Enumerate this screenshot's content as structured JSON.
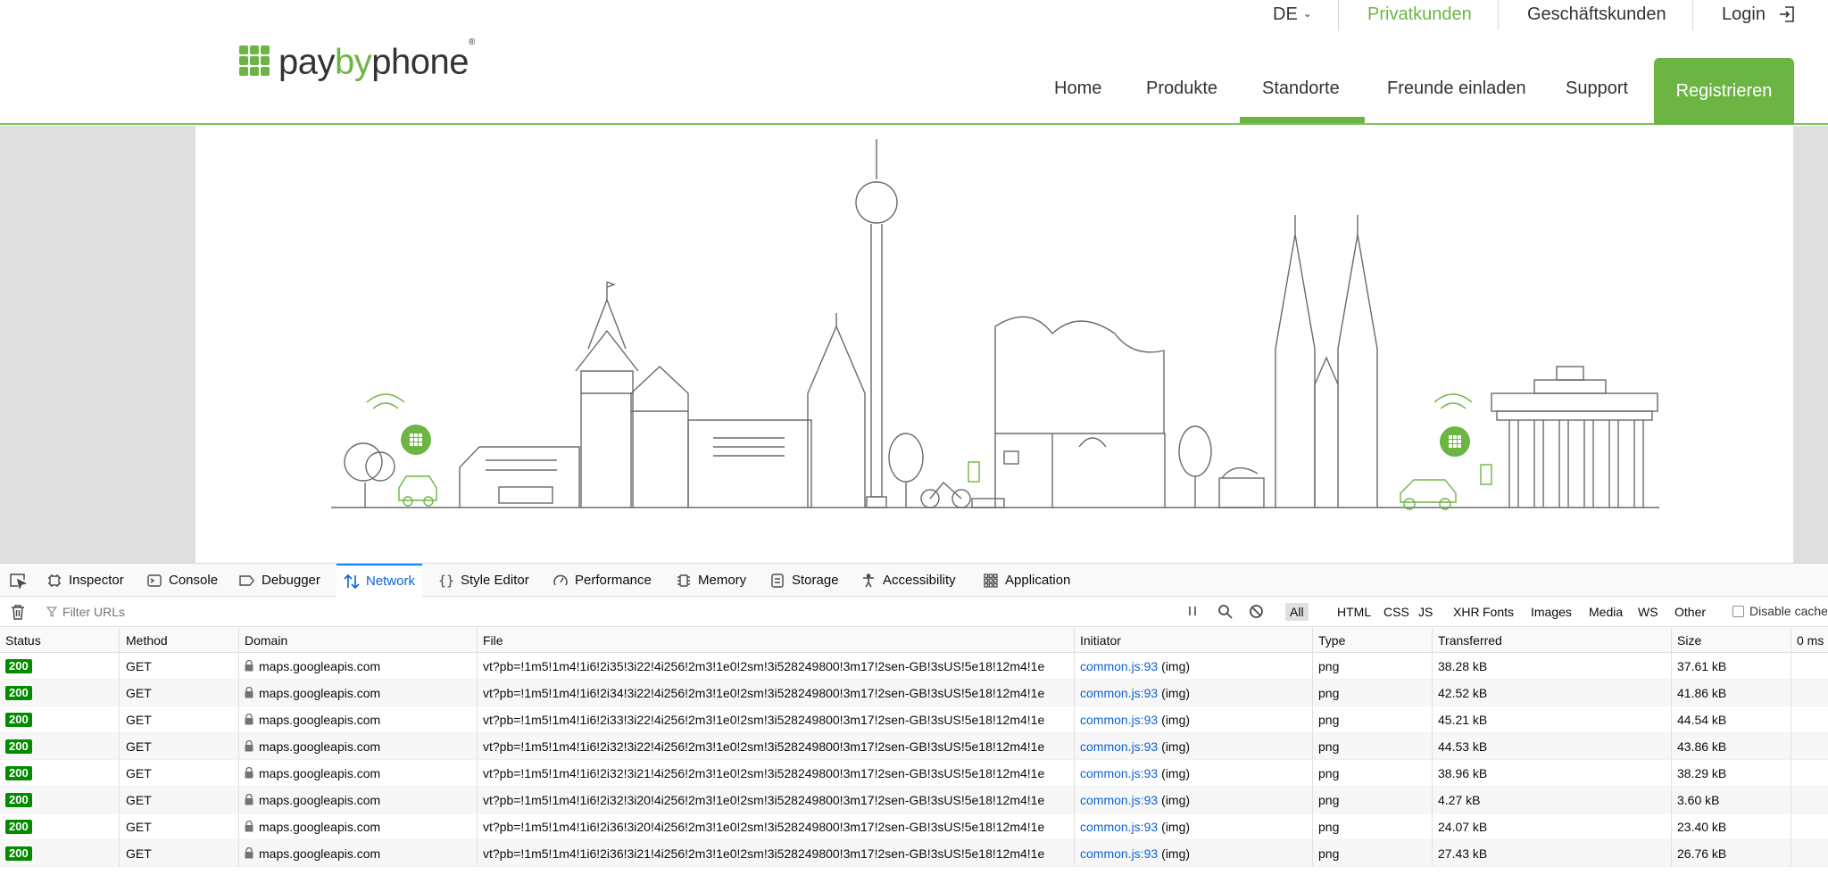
{
  "site": {
    "util": {
      "lang": "DE",
      "privat": "Privatkunden",
      "geschaeft": "Geschäftskunden",
      "login": "Login"
    },
    "logo": {
      "prefix": "pay",
      "mid": "by",
      "suffix": "phone"
    },
    "nav": {
      "home": "Home",
      "produkte": "Produkte",
      "standorte": "Standorte",
      "freunde": "Freunde einladen",
      "support": "Support",
      "register": "Registrieren"
    },
    "accent": "#6cb544"
  },
  "devtools": {
    "tabs": {
      "inspector": "Inspector",
      "console": "Console",
      "debugger": "Debugger",
      "network": "Network",
      "style_editor": "Style Editor",
      "performance": "Performance",
      "memory": "Memory",
      "storage": "Storage",
      "accessibility": "Accessibility",
      "application": "Application"
    },
    "filter_placeholder": "Filter URLs",
    "filters": {
      "all": "All",
      "html": "HTML",
      "css": "CSS",
      "js": "JS",
      "xhr": "XHR",
      "fonts": "Fonts",
      "images": "Images",
      "media": "Media",
      "ws": "WS",
      "other": "Other"
    },
    "disable_cache": "Disable cache",
    "columns": {
      "status": "Status",
      "method": "Method",
      "domain": "Domain",
      "file": "File",
      "initiator": "Initiator",
      "type": "Type",
      "transferred": "Transferred",
      "size": "Size",
      "waterfall": "0 ms"
    },
    "rows": [
      {
        "status": "200",
        "method": "GET",
        "domain": "maps.googleapis.com",
        "file": "vt?pb=!1m5!1m4!1i6!2i35!3i22!4i256!2m3!1e0!2sm!3i528249800!3m17!2sen-GB!3sUS!5e18!12m4!1e",
        "initiator": "common.js:93",
        "initiator_type": "(img)",
        "type": "png",
        "transferred": "38.28 kB",
        "size": "37.61 kB"
      },
      {
        "status": "200",
        "method": "GET",
        "domain": "maps.googleapis.com",
        "file": "vt?pb=!1m5!1m4!1i6!2i34!3i22!4i256!2m3!1e0!2sm!3i528249800!3m17!2sen-GB!3sUS!5e18!12m4!1e",
        "initiator": "common.js:93",
        "initiator_type": "(img)",
        "type": "png",
        "transferred": "42.52 kB",
        "size": "41.86 kB"
      },
      {
        "status": "200",
        "method": "GET",
        "domain": "maps.googleapis.com",
        "file": "vt?pb=!1m5!1m4!1i6!2i33!3i22!4i256!2m3!1e0!2sm!3i528249800!3m17!2sen-GB!3sUS!5e18!12m4!1e",
        "initiator": "common.js:93",
        "initiator_type": "(img)",
        "type": "png",
        "transferred": "45.21 kB",
        "size": "44.54 kB"
      },
      {
        "status": "200",
        "method": "GET",
        "domain": "maps.googleapis.com",
        "file": "vt?pb=!1m5!1m4!1i6!2i32!3i22!4i256!2m3!1e0!2sm!3i528249800!3m17!2sen-GB!3sUS!5e18!12m4!1e",
        "initiator": "common.js:93",
        "initiator_type": "(img)",
        "type": "png",
        "transferred": "44.53 kB",
        "size": "43.86 kB"
      },
      {
        "status": "200",
        "method": "GET",
        "domain": "maps.googleapis.com",
        "file": "vt?pb=!1m5!1m4!1i6!2i32!3i21!4i256!2m3!1e0!2sm!3i528249800!3m17!2sen-GB!3sUS!5e18!12m4!1e",
        "initiator": "common.js:93",
        "initiator_type": "(img)",
        "type": "png",
        "transferred": "38.96 kB",
        "size": "38.29 kB"
      },
      {
        "status": "200",
        "method": "GET",
        "domain": "maps.googleapis.com",
        "file": "vt?pb=!1m5!1m4!1i6!2i32!3i20!4i256!2m3!1e0!2sm!3i528249800!3m17!2sen-GB!3sUS!5e18!12m4!1e",
        "initiator": "common.js:93",
        "initiator_type": "(img)",
        "type": "png",
        "transferred": "4.27 kB",
        "size": "3.60 kB"
      },
      {
        "status": "200",
        "method": "GET",
        "domain": "maps.googleapis.com",
        "file": "vt?pb=!1m5!1m4!1i6!2i36!3i20!4i256!2m3!1e0!2sm!3i528249800!3m17!2sen-GB!3sUS!5e18!12m4!1e",
        "initiator": "common.js:93",
        "initiator_type": "(img)",
        "type": "png",
        "transferred": "24.07 kB",
        "size": "23.40 kB"
      },
      {
        "status": "200",
        "method": "GET",
        "domain": "maps.googleapis.com",
        "file": "vt?pb=!1m5!1m4!1i6!2i36!3i21!4i256!2m3!1e0!2sm!3i528249800!3m17!2sen-GB!3sUS!5e18!12m4!1e",
        "initiator": "common.js:93",
        "initiator_type": "(img)",
        "type": "png",
        "transferred": "27.43 kB",
        "size": "26.76 kB"
      }
    ]
  }
}
